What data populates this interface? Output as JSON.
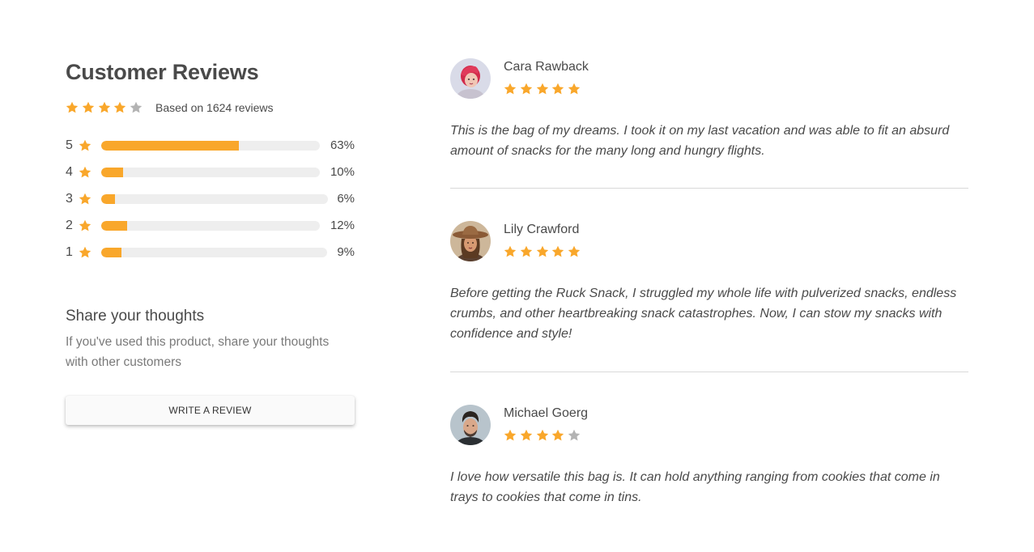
{
  "colors": {
    "star_filled": "#f9a72b",
    "star_empty": "#b3b3b3",
    "bar_fill": "#f9a72b",
    "bar_track": "#eeeeee"
  },
  "summary": {
    "title": "Customer Reviews",
    "rating": 4,
    "max_rating": 5,
    "based_on": "Based on 1624 reviews"
  },
  "distribution": [
    {
      "stars": "5",
      "percent_label": "63%",
      "percent": 63
    },
    {
      "stars": "4",
      "percent_label": "10%",
      "percent": 10
    },
    {
      "stars": "3",
      "percent_label": "6%",
      "percent": 6
    },
    {
      "stars": "2",
      "percent_label": "12%",
      "percent": 12
    },
    {
      "stars": "1",
      "percent_label": "9%",
      "percent": 9
    }
  ],
  "share": {
    "title": "Share your thoughts",
    "description": "If you've used this product, share your thoughts with other customers",
    "button_label": "WRITE A REVIEW"
  },
  "reviews": [
    {
      "name": "Cara Rawback",
      "rating": 5,
      "avatar": "avatar-woman-red-hair",
      "text": "This is the bag of my dreams. I took it on my last vacation and was able to fit an absurd amount of snacks for the many long and hungry flights."
    },
    {
      "name": "Lily Crawford",
      "rating": 5,
      "avatar": "avatar-woman-hat",
      "text": "Before getting the Ruck Snack, I struggled my whole life with pulverized snacks, endless crumbs, and other heartbreaking snack catastrophes. Now, I can stow my snacks with confidence and style!"
    },
    {
      "name": "Michael Goerg",
      "rating": 4,
      "avatar": "avatar-man-dark-hair",
      "text": "I love how versatile this bag is. It can hold anything ranging from cookies that come in trays to cookies that come in tins."
    }
  ]
}
